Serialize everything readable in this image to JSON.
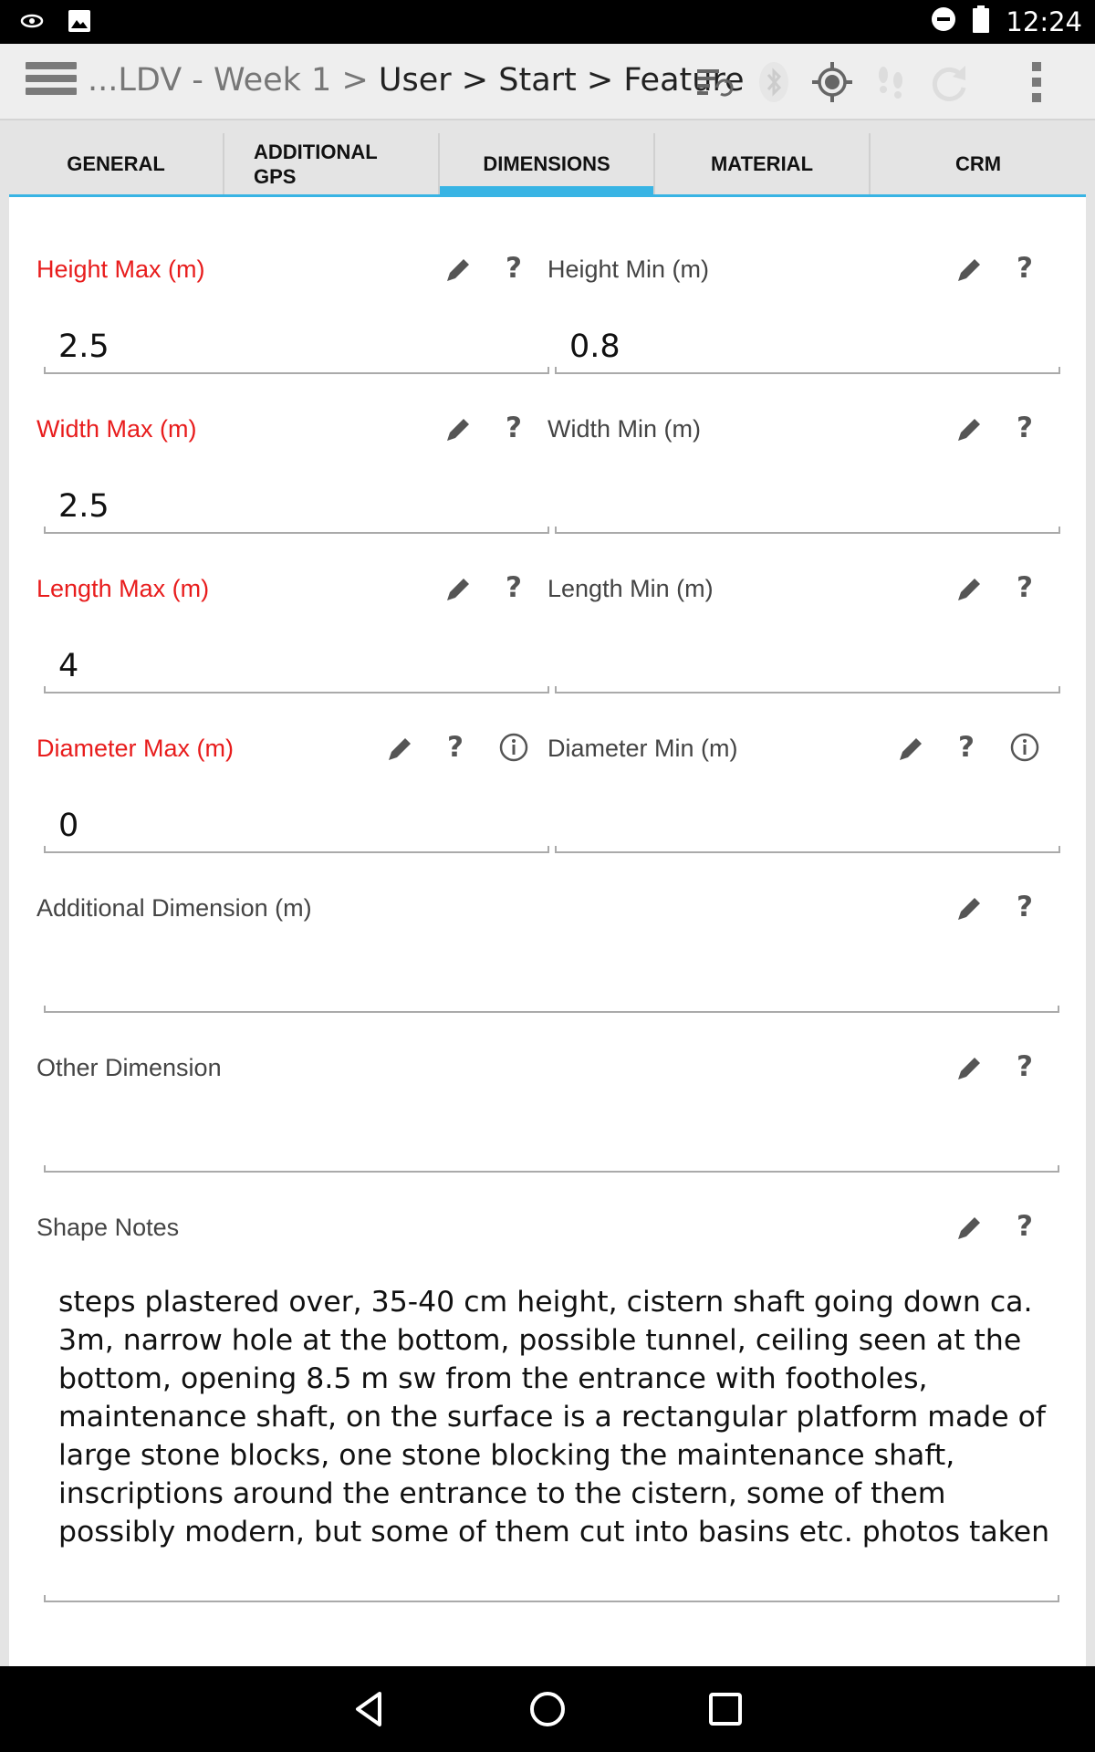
{
  "status_bar": {
    "time": "12:24",
    "icons": [
      "eye-icon",
      "image-icon",
      "do-not-disturb-icon",
      "battery-icon"
    ]
  },
  "action_bar": {
    "breadcrumb_muted": "...LDV - Week 1 > ",
    "breadcrumb_main": "User > Start > Feature",
    "icons": [
      "sync-list-icon",
      "bluetooth-icon",
      "gps-target-icon",
      "footsteps-icon",
      "refresh-icon",
      "overflow-menu-icon"
    ]
  },
  "tabs": [
    {
      "label": "GENERAL",
      "active": false
    },
    {
      "label": "ADDITIONAL GPS",
      "active": false
    },
    {
      "label": "DIMENSIONS",
      "active": true
    },
    {
      "label": "MATERIAL",
      "active": false
    },
    {
      "label": "CRM",
      "active": false
    }
  ],
  "fields": {
    "height_max": {
      "label": "Height Max (m)",
      "value": "2.5",
      "required": true
    },
    "height_min": {
      "label": "Height Min (m)",
      "value": "0.8",
      "required": false
    },
    "width_max": {
      "label": "Width Max (m)",
      "value": "2.5",
      "required": true
    },
    "width_min": {
      "label": "Width Min (m)",
      "value": "",
      "required": false
    },
    "length_max": {
      "label": "Length Max (m)",
      "value": "4",
      "required": true
    },
    "length_min": {
      "label": "Length Min (m)",
      "value": "",
      "required": false
    },
    "diameter_max": {
      "label": "Diameter Max (m)",
      "value": "0",
      "required": true
    },
    "diameter_min": {
      "label": "Diameter Min (m)",
      "value": "",
      "required": false
    },
    "additional_dimension": {
      "label": "Additional Dimension (m)",
      "value": ""
    },
    "other_dimension": {
      "label": "Other Dimension",
      "value": ""
    },
    "shape_notes": {
      "label": "Shape Notes",
      "value": "steps plastered over, 35-40 cm height, cistern shaft going down ca. 3m, narrow hole at the bottom, possible tunnel, ceiling seen at the bottom, opening 8.5 m sw from the entrance with footholes, maintenance shaft, on the surface is a rectangular platform made of large stone blocks, one stone blocking the maintenance shaft, inscriptions around the entrance to the cistern, some of them possibly modern, but some of them cut into basins etc. photos taken"
    }
  },
  "help_glyph": "?",
  "colors": {
    "required_label": "#e81c1c",
    "accent": "#38b4e4"
  },
  "nav_bar": {
    "icons": [
      "back-icon",
      "home-icon",
      "recents-icon"
    ]
  }
}
